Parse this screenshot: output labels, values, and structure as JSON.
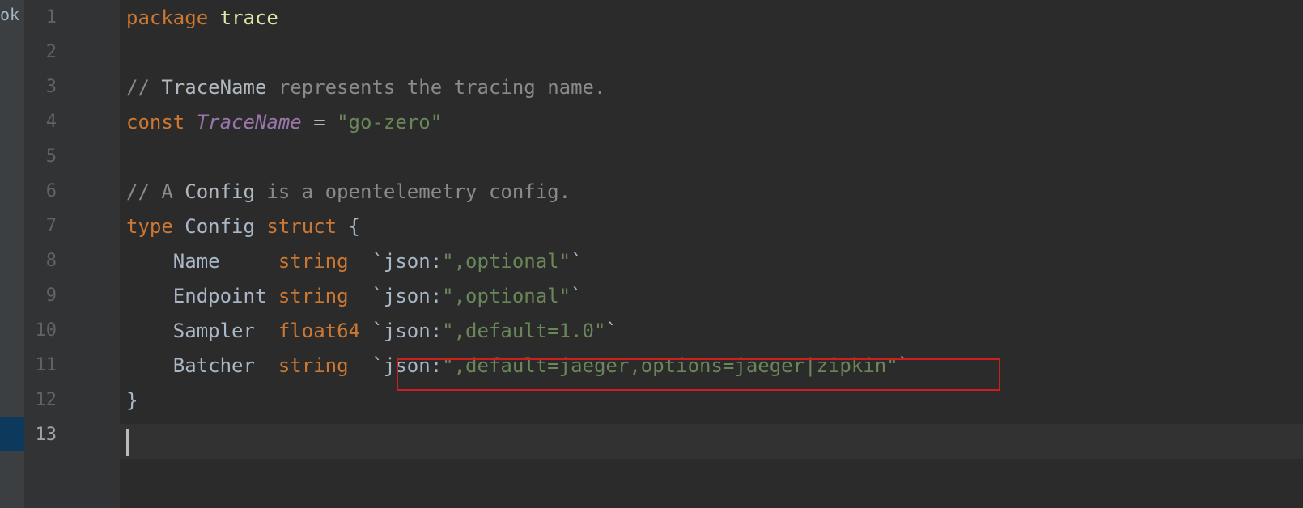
{
  "sidebar": {
    "stub_text": "ok"
  },
  "editor": {
    "current_line": 13,
    "lines": [
      {
        "num": "1",
        "tokens": [
          {
            "t": "package",
            "c": "kw"
          },
          {
            "t": " ",
            "c": "id"
          },
          {
            "t": "trace",
            "c": "pkg"
          }
        ]
      },
      {
        "num": "2",
        "tokens": []
      },
      {
        "num": "3",
        "tokens": [
          {
            "t": "// ",
            "c": "comment"
          },
          {
            "t": "TraceName",
            "c": "comment-ref"
          },
          {
            "t": " represents the tracing name.",
            "c": "comment"
          }
        ]
      },
      {
        "num": "4",
        "tokens": [
          {
            "t": "const",
            "c": "kw"
          },
          {
            "t": " ",
            "c": "id"
          },
          {
            "t": "TraceName",
            "c": "const-name"
          },
          {
            "t": " = ",
            "c": "op"
          },
          {
            "t": "\"go-zero\"",
            "c": "str"
          }
        ]
      },
      {
        "num": "5",
        "tokens": []
      },
      {
        "num": "6",
        "tokens": [
          {
            "t": "// A ",
            "c": "comment"
          },
          {
            "t": "Config",
            "c": "comment-ref"
          },
          {
            "t": " is a opentelemetry config.",
            "c": "comment"
          }
        ]
      },
      {
        "num": "7",
        "tokens": [
          {
            "t": "type",
            "c": "kw"
          },
          {
            "t": " Config ",
            "c": "id"
          },
          {
            "t": "struct",
            "c": "kw"
          },
          {
            "t": " {",
            "c": "op"
          }
        ]
      },
      {
        "num": "8",
        "tokens": [
          {
            "t": "    Name     ",
            "c": "field"
          },
          {
            "t": "string",
            "c": "kw"
          },
          {
            "t": "  `json:",
            "c": "tag-text"
          },
          {
            "t": "\",optional\"",
            "c": "str"
          },
          {
            "t": "`",
            "c": "tag-text"
          }
        ]
      },
      {
        "num": "9",
        "tokens": [
          {
            "t": "    Endpoint ",
            "c": "field"
          },
          {
            "t": "string",
            "c": "kw"
          },
          {
            "t": "  `json:",
            "c": "tag-text"
          },
          {
            "t": "\",optional\"",
            "c": "str"
          },
          {
            "t": "`",
            "c": "tag-text"
          }
        ]
      },
      {
        "num": "10",
        "tokens": [
          {
            "t": "    Sampler  ",
            "c": "field"
          },
          {
            "t": "float64",
            "c": "kw"
          },
          {
            "t": " `json:",
            "c": "tag-text"
          },
          {
            "t": "\",default=1.0\"",
            "c": "str"
          },
          {
            "t": "`",
            "c": "tag-text"
          }
        ]
      },
      {
        "num": "11",
        "tokens": [
          {
            "t": "    Batcher  ",
            "c": "field"
          },
          {
            "t": "string",
            "c": "kw"
          },
          {
            "t": "  `json:",
            "c": "tag-text"
          },
          {
            "t": "\",default=jaeger,options=jaeger|zipkin\"",
            "c": "str"
          },
          {
            "t": "`",
            "c": "tag-text"
          }
        ]
      },
      {
        "num": "12",
        "tokens": [
          {
            "t": "}",
            "c": "op"
          }
        ]
      },
      {
        "num": "13",
        "tokens": []
      }
    ]
  },
  "colors": {
    "background": "#2b2b2b",
    "gutter": "#313335",
    "keyword": "#cc7832",
    "string": "#6a8759",
    "constant": "#9876aa",
    "comment": "#8a8a8a",
    "highlight_border": "#d01d1d"
  }
}
